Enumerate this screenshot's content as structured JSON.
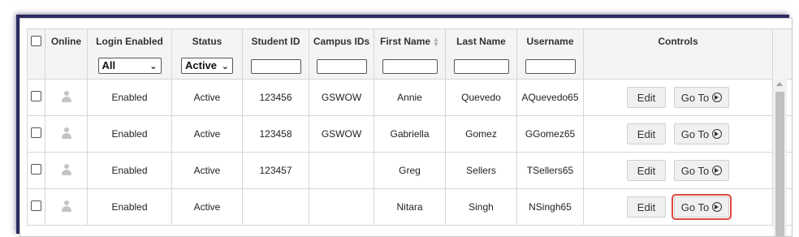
{
  "columns": {
    "online": "Online",
    "login_enabled": "Login Enabled",
    "status": "Status",
    "student_id": "Student ID",
    "campus_ids": "Campus IDs",
    "first_name": "First Name",
    "last_name": "Last Name",
    "username": "Username",
    "controls": "Controls"
  },
  "filters": {
    "login_enabled_value": "All",
    "status_value": "Active"
  },
  "buttons": {
    "edit": "Edit",
    "goto": "Go To"
  },
  "rows": [
    {
      "login": "Enabled",
      "status": "Active",
      "student_id": "123456",
      "campus": "GSWOW",
      "first": "Annie",
      "last": "Quevedo",
      "username": "AQuevedo65"
    },
    {
      "login": "Enabled",
      "status": "Active",
      "student_id": "123458",
      "campus": "GSWOW",
      "first": "Gabriella",
      "last": "Gomez",
      "username": "GGomez65"
    },
    {
      "login": "Enabled",
      "status": "Active",
      "student_id": "123457",
      "campus": "",
      "first": "Greg",
      "last": "Sellers",
      "username": "TSellers65"
    },
    {
      "login": "Enabled",
      "status": "Active",
      "student_id": "",
      "campus": "",
      "first": "Nitara",
      "last": "Singh",
      "username": "NSingh65"
    }
  ],
  "icons": {
    "online": "person-icon",
    "goto": "arrow-circle-right-icon",
    "sort": "sort-icon"
  },
  "colors": {
    "frame_shadow": "#2d2b63",
    "highlight": "#e0483e"
  }
}
